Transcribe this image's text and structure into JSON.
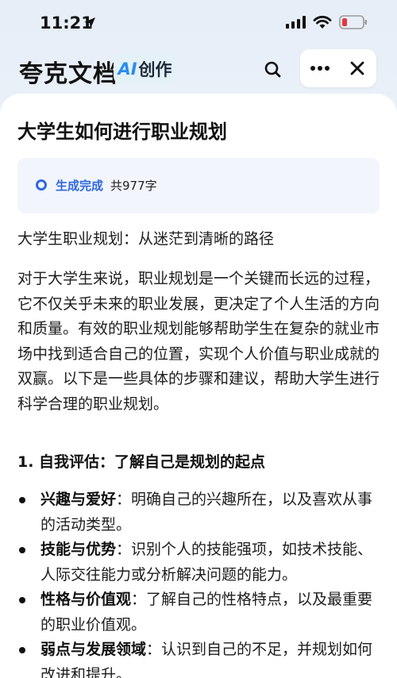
{
  "status_bar": {
    "time": "11:21",
    "icons": [
      "location-arrow-icon",
      "cellular-signal-icon",
      "wifi-icon",
      "battery-low-icon"
    ]
  },
  "header": {
    "app_title": "夸克文档",
    "ai_badge_ai": "AI",
    "ai_badge_text": "创作",
    "icons": [
      "search-icon",
      "more-icon",
      "close-icon"
    ]
  },
  "document": {
    "title": "大学生如何进行职业规划",
    "generation": {
      "status": "生成完成",
      "count": "共977字"
    },
    "subtitle": "大学生职业规划：从迷茫到清晰的路径",
    "intro": "对于大学生来说，职业规划是一个关键而长远的过程，它不仅关乎未来的职业发展，更决定了个人生活的方向和质量。有效的职业规划能够帮助学生在复杂的就业市场中找到适合自己的位置，实现个人价值与职业成就的双赢。以下是一些具体的步骤和建议，帮助大学生进行科学合理的职业规划。",
    "section1_heading": "1. 自我评估：了解自己是规划的起点",
    "section1_items": [
      {
        "term": "兴趣与爱好",
        "text": "：明确自己的兴趣所在，以及喜欢从事的活动类型。"
      },
      {
        "term": "技能与优势",
        "text": "：识别个人的技能强项，如技术技能、人际交往能力或分析解决问题的能力。"
      },
      {
        "term": "性格与价值观",
        "text": "：了解自己的性格特点，以及最重要的职业价值观。"
      },
      {
        "term": "弱点与发展领域",
        "text": "：认识到自己的不足，并规划如何改进和提升。"
      }
    ]
  },
  "colors": {
    "accent": "#2f68e0",
    "ai_blue": "#2b8cf0",
    "battery_red": "#e5383b"
  }
}
